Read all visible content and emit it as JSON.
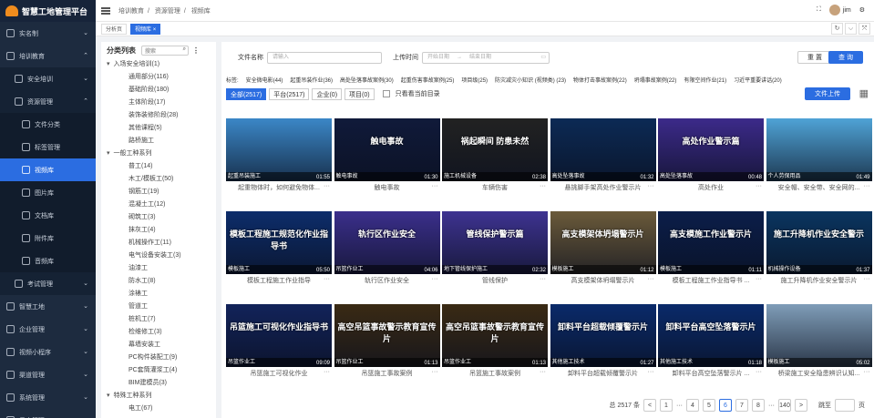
{
  "app": {
    "title": "智慧工地管理平台"
  },
  "colors": {
    "accent": "#2b6de1",
    "sidebar": "#1d2b3f"
  },
  "sidebar": {
    "items": [
      {
        "label": "实名制",
        "level": 0
      },
      {
        "label": "培训教育",
        "level": 0,
        "open": true
      },
      {
        "label": "安全培训",
        "level": 1
      },
      {
        "label": "资源管理",
        "level": 1,
        "open": true
      },
      {
        "label": "文件分类",
        "level": 2
      },
      {
        "label": "标签管理",
        "level": 2
      },
      {
        "label": "视频库",
        "level": 2,
        "active": true
      },
      {
        "label": "图片库",
        "level": 2
      },
      {
        "label": "文档库",
        "level": 2
      },
      {
        "label": "附件库",
        "level": 2
      },
      {
        "label": "音频库",
        "level": 2
      },
      {
        "label": "考试管理",
        "level": 1
      },
      {
        "label": "智慧工地",
        "level": 0
      },
      {
        "label": "企业管理",
        "level": 0
      },
      {
        "label": "视频小程序",
        "level": 0
      },
      {
        "label": "渠道管理",
        "level": 0
      },
      {
        "label": "系统管理",
        "level": 0
      },
      {
        "label": "日志管理",
        "level": 0
      }
    ]
  },
  "topbar": {
    "breadcrumb": [
      "培训教育",
      "资源管理",
      "视频库"
    ],
    "separator": "/",
    "user": "jim",
    "icons": [
      "fullscreen-icon",
      "gear-icon"
    ]
  },
  "tabs": {
    "items": [
      "分析页",
      "视频库"
    ],
    "close": "×",
    "controls": [
      "↻",
      "⌵",
      "⤧"
    ]
  },
  "tree": {
    "title": "分类列表",
    "search_placeholder": "搜索",
    "items": [
      {
        "label": "入场安全培训(1)",
        "level": 1
      },
      {
        "label": "通用部分(116)",
        "level": 2
      },
      {
        "label": "基础阶段(180)",
        "level": 2
      },
      {
        "label": "主体阶段(17)",
        "level": 2
      },
      {
        "label": "装饰装修阶段(28)",
        "level": 2
      },
      {
        "label": "其他课程(5)",
        "level": 2
      },
      {
        "label": "路桥施工",
        "level": 2
      },
      {
        "label": "一般工种系列",
        "level": 1
      },
      {
        "label": "普工(14)",
        "level": 2
      },
      {
        "label": "木工/模板工(50)",
        "level": 2
      },
      {
        "label": "钢筋工(19)",
        "level": 2
      },
      {
        "label": "混凝土工(12)",
        "level": 2
      },
      {
        "label": "砌筑工(3)",
        "level": 2
      },
      {
        "label": "抹灰工(4)",
        "level": 2
      },
      {
        "label": "机械操作工(11)",
        "level": 2
      },
      {
        "label": "电气设备安装工(3)",
        "level": 2
      },
      {
        "label": "油漆工",
        "level": 2
      },
      {
        "label": "防水工(8)",
        "level": 2
      },
      {
        "label": "涂裱工",
        "level": 2
      },
      {
        "label": "管道工",
        "level": 2
      },
      {
        "label": "桩机工(7)",
        "level": 2
      },
      {
        "label": "检维修工(3)",
        "level": 2
      },
      {
        "label": "幕墙安装工",
        "level": 2
      },
      {
        "label": "PC构件装配工(9)",
        "level": 2
      },
      {
        "label": "PC套筒灌浆工(4)",
        "level": 2
      },
      {
        "label": "BIM建模员(3)",
        "level": 2
      },
      {
        "label": "特殊工种系列",
        "level": 1
      },
      {
        "label": "电工(67)",
        "level": 2
      }
    ]
  },
  "filter": {
    "name_label": "文件名称",
    "name_placeholder": "请输入",
    "time_label": "上传时间",
    "start_placeholder": "开始日期",
    "arrow": "→",
    "end_placeholder": "结束日期",
    "reset": "重 置",
    "query": "查 询"
  },
  "tags": {
    "label": "标签:",
    "items": [
      "安全微电影(44)",
      "起重吊装作业(36)",
      "高处坠落事故案例(30)",
      "起重伤害事故案例(25)",
      "项目级(25)",
      "防灾减灾小知识 (视频类) (23)",
      "物体打击事故案例(22)",
      "坍塌事故案例(22)",
      "有限空间作业(21)",
      "习近平重要讲话(20)"
    ]
  },
  "types": {
    "items": [
      "全部(2517)",
      "平台(2517)",
      "企业(0)",
      "项目(0)"
    ],
    "only_current": "只看看当前目录",
    "upload": "文件上传"
  },
  "videos": [
    {
      "title": "起重吊装施工",
      "name": "起重物体时，如何避免物体...",
      "duration": "01:55",
      "overlay": "",
      "bg": "#3b87c7"
    },
    {
      "title": "触电事故",
      "name": "触电事故",
      "duration": "01:30",
      "overlay": "触电事故",
      "bg": "#101a3a"
    },
    {
      "title": "施工机械设备",
      "name": "车辆伤害",
      "duration": "02:38",
      "overlay": "祸起瞬间 防患未然",
      "bg": "#222"
    },
    {
      "title": "高处坠落事故",
      "name": "悬挑脚手架高处作业警示片",
      "duration": "01:32",
      "overlay": "",
      "bg": "#0c2a55"
    },
    {
      "title": "高处坠落事故",
      "name": "高处作业",
      "duration": "00:48",
      "overlay": "高处作业警示篇",
      "bg": "#3c2a8a"
    },
    {
      "title": "个人劳保用品",
      "name": "安全帽、安全带、安全网的...",
      "duration": "01:49",
      "overlay": "",
      "bg": "#4fa3d6"
    },
    {
      "title": "模板施工",
      "name": "模板工程施工作业指导",
      "duration": "05:50",
      "overlay": "模板工程施工规范化作业指导书",
      "bg": "#0d2d6b"
    },
    {
      "title": "吊篮作业工",
      "name": "轨行区作业安全",
      "duration": "04:06",
      "overlay": "轨行区作业安全",
      "bg": "#3b2f8c"
    },
    {
      "title": "地下管线保护施工",
      "name": "管线保护",
      "duration": "02:32",
      "overlay": "管线保护警示篇",
      "bg": "#3e3391"
    },
    {
      "title": "模板施工",
      "name": "高支模架体坍塌警示片",
      "duration": "01:12",
      "overlay": "高支模架体坍塌警示片",
      "bg": "#6b5a3a"
    },
    {
      "title": "模板施工",
      "name": "模板工程施工作业指导书 ...",
      "duration": "01:11",
      "overlay": "高支模施工作业警示片",
      "bg": "#0b1e4a"
    },
    {
      "title": "机械操作设备",
      "name": "施工升降机作业安全警示片",
      "duration": "01:37",
      "overlay": "施工升降机作业安全警示",
      "bg": "#0a3560"
    },
    {
      "title": "吊篮作业工",
      "name": "吊篮施工可视化作业",
      "duration": "09:09",
      "overlay": "吊篮施工可视化作业指导书",
      "bg": "#12235a"
    },
    {
      "title": "吊篮作业工",
      "name": "吊篮施工事故案例",
      "duration": "01:13",
      "overlay": "高空吊篮事故警示教育宣传片",
      "bg": "#3a2a14"
    },
    {
      "title": "吊篮作业工",
      "name": "吊篮施工事故案例",
      "duration": "01:13",
      "overlay": "高空吊篮事故警示教育宣传片",
      "bg": "#3a2a14"
    },
    {
      "title": "其他施工技术",
      "name": "卸料平台超载倾覆警示片",
      "duration": "01:27",
      "overlay": "卸料平台超载倾覆警示片",
      "bg": "#0a2a6a"
    },
    {
      "title": "其他施工技术",
      "name": "卸料平台高空坠落警示片 ...",
      "duration": "01:18",
      "overlay": "卸料平台高空坠落警示片",
      "bg": "#0a2a6a"
    },
    {
      "title": "模板施工",
      "name": "桥梁施工安全隐患辨识认知...",
      "duration": "05:02",
      "overlay": "",
      "bg": "#7f9db8"
    }
  ],
  "pager": {
    "total": "总 2517 条",
    "prev": "<",
    "next": ">",
    "pages": [
      "1",
      "···",
      "4",
      "5",
      "6",
      "7",
      "8",
      "···",
      "140"
    ],
    "current": "6",
    "jump_label": "跳至",
    "page_unit": "页",
    "more": "···"
  }
}
